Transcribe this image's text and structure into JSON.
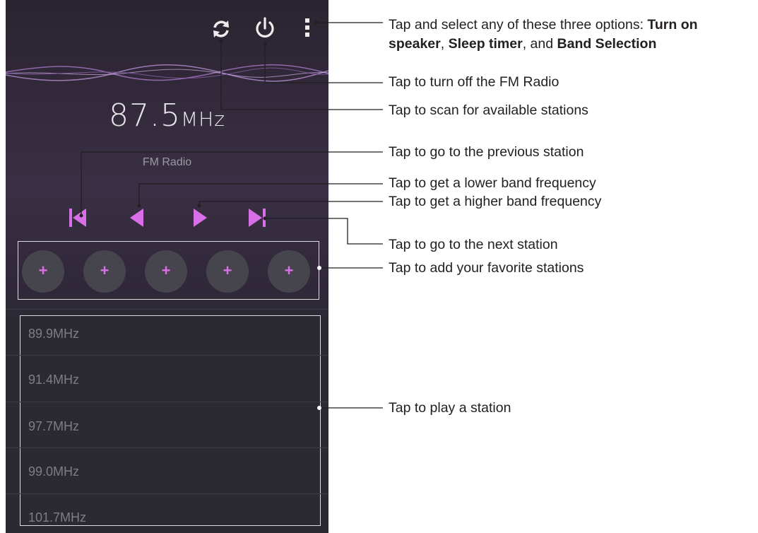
{
  "screen": {
    "frequency_value": "87.5",
    "frequency_unit": "MHz",
    "band_label": "FM Radio",
    "icons": [
      "refresh-icon",
      "power-icon",
      "more-vert-icon"
    ],
    "controls": [
      "previous-station-icon",
      "lower-frequency-icon",
      "higher-frequency-icon",
      "next-station-icon"
    ],
    "favorites": [
      "+",
      "+",
      "+",
      "+",
      "+"
    ],
    "stations": [
      "89.9MHz",
      "91.4MHz",
      "97.7MHz",
      "99.0MHz",
      "101.7MHz"
    ],
    "colors": {
      "accent": "#d86ee8",
      "background": "#2b2a33",
      "wave": "#9b6fb8"
    }
  },
  "annotations": {
    "menu_prefix": "Tap and select any of these three options: ",
    "menu_opt1": "Turn on speaker",
    "menu_sep1": ", ",
    "menu_opt2": "Sleep timer",
    "menu_sep2": ", and ",
    "menu_opt3": "Band Selection",
    "power": "Tap to turn off the FM Radio",
    "scan": "Tap to scan for available stations",
    "previous": "Tap to go to the previous station",
    "lower": "Tap to get a lower band frequency",
    "higher": "Tap to get a higher band frequency",
    "next": "Tap to go to the next station",
    "favorites": "Tap to add your favorite stations",
    "play": "Tap to play a station"
  }
}
